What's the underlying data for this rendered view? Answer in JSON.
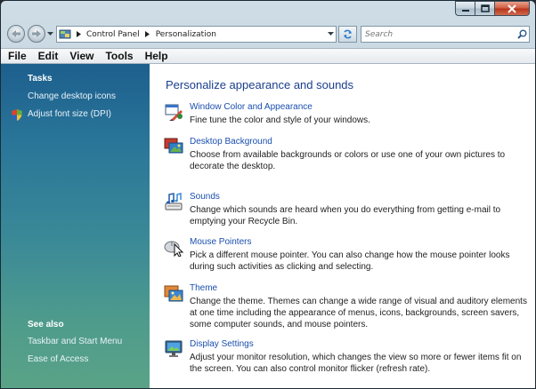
{
  "window": {
    "controls": {
      "minimize": "minimize",
      "maximize": "maximize",
      "close": "close"
    }
  },
  "navigation": {
    "breadcrumb": [
      "Control Panel",
      "Personalization"
    ],
    "search": {
      "placeholder": "Search",
      "value": ""
    }
  },
  "menubar": {
    "items": [
      "File",
      "Edit",
      "View",
      "Tools",
      "Help"
    ]
  },
  "sidebar": {
    "tasks_heading": "Tasks",
    "tasks": [
      "Change desktop icons",
      "Adjust font size (DPI)"
    ],
    "see_also_heading": "See also",
    "see_also": [
      "Taskbar and Start Menu",
      "Ease of Access"
    ]
  },
  "content": {
    "title": "Personalize appearance and sounds",
    "items": [
      {
        "icon": "window-color-icon",
        "title": "Window Color and Appearance",
        "description": "Fine tune the color and style of your windows."
      },
      {
        "icon": "desktop-background-icon",
        "title": "Desktop Background",
        "description": "Choose from available backgrounds or colors or use one of your own pictures to decorate the desktop."
      },
      {
        "icon": "sounds-icon",
        "title": "Sounds",
        "description": "Change which sounds are heard when you do everything from getting e-mail to emptying your Recycle Bin."
      },
      {
        "icon": "mouse-pointers-icon",
        "title": "Mouse Pointers",
        "description": "Pick a different mouse pointer. You can also change how the mouse pointer looks during such activities as clicking and selecting."
      },
      {
        "icon": "theme-icon",
        "title": "Theme",
        "description": "Change the theme. Themes can change a wide range of visual and auditory elements at one time including the appearance of menus, icons, backgrounds, screen savers, some computer sounds, and mouse pointers."
      },
      {
        "icon": "display-settings-icon",
        "title": "Display Settings",
        "description": "Adjust your monitor resolution, which changes the view so more or fewer items fit on the screen. You can also control monitor flicker (refresh rate)."
      }
    ]
  }
}
